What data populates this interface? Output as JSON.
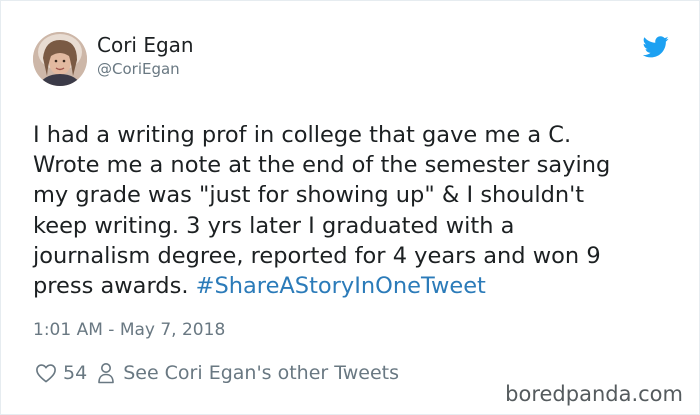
{
  "author": {
    "display_name": "Cori Egan",
    "handle": "@CoriEgan",
    "avatar_icon": "profile-photo"
  },
  "brand": {
    "icon": "twitter-bird-icon",
    "color": "#1da1f2"
  },
  "tweet": {
    "lines": [
      "I had a writing prof in college that gave me a C.",
      "Wrote me a note at the end of the semester saying",
      "my grade was \"just for showing up\" & I shouldn't",
      "keep writing. 3 yrs later I graduated with a",
      "journalism degree, reported for 4 years and won 9"
    ],
    "last_line_text": "press awards. ",
    "hashtag": "#ShareAStoryInOneTweet",
    "hashtag_color": "#2b7bb9"
  },
  "meta": {
    "timestamp": "1:01 AM - May 7, 2018"
  },
  "actions": {
    "like_count": "54",
    "other_tweets_label": "See Cori Egan's other Tweets"
  },
  "watermark": {
    "text": "boredpanda.com"
  }
}
